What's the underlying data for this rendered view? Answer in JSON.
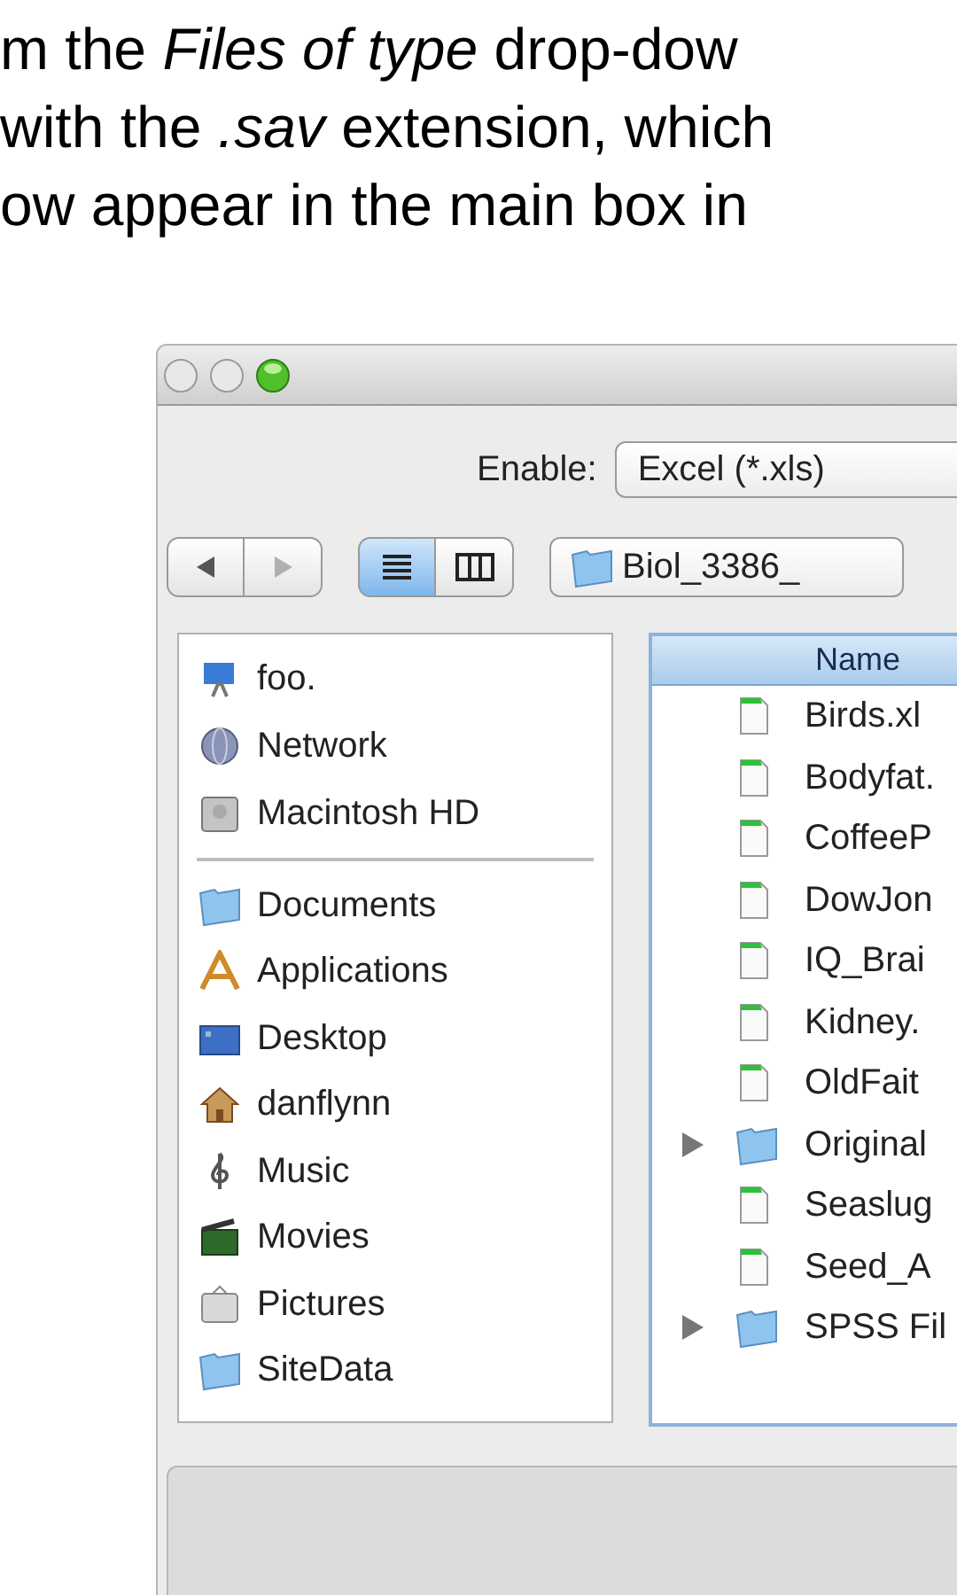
{
  "document_text": [
    "m the *Files of type* drop-dow",
    "with the *.sav* extension, which",
    "ow appear in the main box in"
  ],
  "dialog": {
    "enable_label": "Enable:",
    "enable_value": "Excel (*.xls)",
    "nav": [
      {
        "kind": "back",
        "disabled": false
      },
      {
        "kind": "forward",
        "disabled": true
      }
    ],
    "views": [
      {
        "kind": "list",
        "selected": true
      },
      {
        "kind": "columns",
        "selected": false
      }
    ],
    "path": "Biol_3386_",
    "sidebar": {
      "devices": [
        {
          "name": "foo.",
          "kind": "computer"
        },
        {
          "name": "Network",
          "kind": "network"
        },
        {
          "name": "Macintosh HD",
          "kind": "disk"
        }
      ],
      "places": [
        {
          "name": "Documents",
          "kind": "folder"
        },
        {
          "name": "Applications",
          "kind": "apps"
        },
        {
          "name": "Desktop",
          "kind": "desktop"
        },
        {
          "name": "danflynn",
          "kind": "home"
        },
        {
          "name": "Music",
          "kind": "music"
        },
        {
          "name": "Movies",
          "kind": "movies"
        },
        {
          "name": "Pictures",
          "kind": "pictures"
        },
        {
          "name": "SiteData",
          "kind": "folder"
        }
      ]
    },
    "files": {
      "column": "Name",
      "rows": [
        {
          "name": "Birds.xl",
          "kind": "file"
        },
        {
          "name": "Bodyfat.",
          "kind": "file"
        },
        {
          "name": "CoffeeP",
          "kind": "file"
        },
        {
          "name": "DowJon",
          "kind": "file"
        },
        {
          "name": "IQ_Brai",
          "kind": "file"
        },
        {
          "name": "Kidney.",
          "kind": "file"
        },
        {
          "name": "OldFait",
          "kind": "file"
        },
        {
          "name": "Original",
          "kind": "folder"
        },
        {
          "name": "Seaslug",
          "kind": "file"
        },
        {
          "name": "Seed_A",
          "kind": "file"
        },
        {
          "name": "SPSS Fil",
          "kind": "folder"
        }
      ]
    }
  }
}
